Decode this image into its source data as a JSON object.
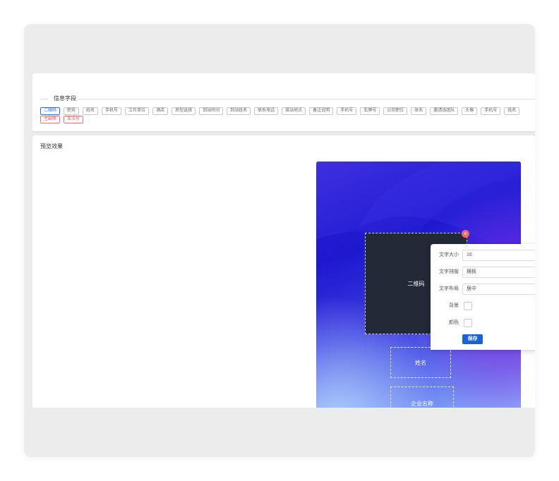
{
  "fields_panel": {
    "title": "信息字段",
    "tags_row1": [
      "二维码",
      "职务",
      "姓名",
      "手机号",
      "工作单位",
      "酒店",
      "房型选择",
      "到站时间",
      "到站姓名",
      "联系电话",
      "接站地点",
      "备注说明",
      "手机号",
      "车牌号",
      "公司职位",
      "体系",
      "邀请函团队",
      "头像",
      "手机号",
      "姓名"
    ],
    "tags_row2": [
      "主副席",
      "车次号"
    ],
    "active_color": "#2f6fe0",
    "alert_color": "#d9534f"
  },
  "preview": {
    "title": "预览效果",
    "qr_label": "二维码",
    "close_icon": "×",
    "name_label": "姓名",
    "company_label": "企业名称"
  },
  "settings": {
    "font_size_label": "文字大小",
    "font_size_value": "16",
    "text_layout_label": "文字排版",
    "text_layout_value": "横板",
    "text_align_label": "文字布局",
    "text_align_value": "居中",
    "background_label": "背景",
    "background_color": "#e61b1b",
    "color_label": "颜色",
    "text_color": "#111111",
    "save_label": "保存"
  }
}
